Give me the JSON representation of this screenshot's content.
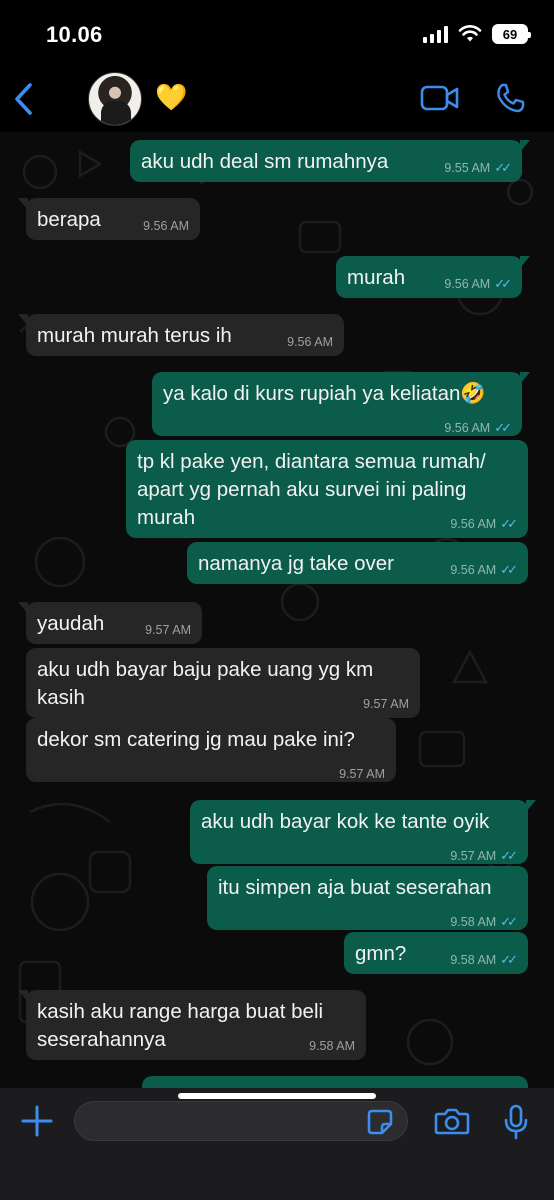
{
  "status_bar": {
    "time": "10.06",
    "battery": "69"
  },
  "header": {
    "emoji": "💛"
  },
  "messages": [
    {
      "dir": "out",
      "text": "aku udh deal sm rumahnya",
      "time": "9.55 AM",
      "read": true
    },
    {
      "dir": "in",
      "text": "berapa",
      "time": "9.56 AM"
    },
    {
      "dir": "out",
      "text": "murah",
      "time": "9.56 AM",
      "read": true
    },
    {
      "dir": "in",
      "text": "murah murah terus ih",
      "time": "9.56 AM"
    },
    {
      "dir": "out",
      "text": "ya kalo di kurs rupiah ya keliatan🤣",
      "time": "9.56 AM",
      "read": true
    },
    {
      "dir": "out",
      "text": "tp kl pake yen, diantara semua rumah/ apart yg pernah aku survei ini paling murah",
      "time": "9.56 AM",
      "read": true
    },
    {
      "dir": "out",
      "text": "namanya jg take over",
      "time": "9.56 AM",
      "read": true
    },
    {
      "dir": "in",
      "text": "yaudah",
      "time": "9.57 AM"
    },
    {
      "dir": "in",
      "text": "aku udh bayar baju pake uang yg km kasih",
      "time": "9.57 AM"
    },
    {
      "dir": "in",
      "text": "dekor sm catering jg mau pake ini?",
      "time": "9.57 AM"
    },
    {
      "dir": "out",
      "text": "aku udh bayar kok ke tante oyik",
      "time": "9.57 AM",
      "read": true
    },
    {
      "dir": "out",
      "text": "itu simpen aja buat seserahan",
      "time": "9.58 AM",
      "read": true
    },
    {
      "dir": "out",
      "text": "gmn?",
      "time": "9.58 AM",
      "read": true
    },
    {
      "dir": "in",
      "text": "kasih aku range harga buat beli seserahannya",
      "time": "9.58 AM"
    }
  ],
  "input": {
    "value": ""
  },
  "colors": {
    "accent": "#3b8df0",
    "outgoing": "#0b5c4a",
    "incoming": "#262626",
    "read_ticks": "#53bdeb"
  },
  "icons": [
    "back-chevron-icon",
    "video-call-icon",
    "phone-icon",
    "plus-icon",
    "sticker-icon",
    "camera-icon",
    "microphone-icon"
  ]
}
